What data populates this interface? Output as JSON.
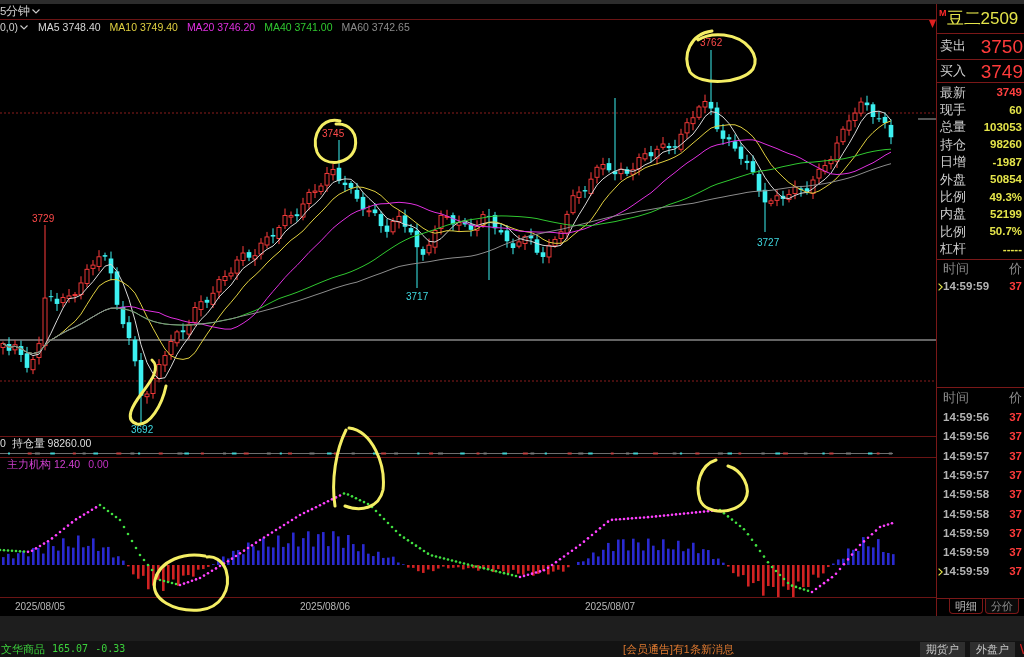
{
  "chart_header": {
    "period": "5分钟"
  },
  "legend": {
    "params": "0,0)",
    "averages": [
      {
        "label": "MA5",
        "value": "3748.40",
        "color": "#d8d8d8"
      },
      {
        "label": "MA10",
        "value": "3749.40",
        "color": "#e0d040"
      },
      {
        "label": "MA20",
        "value": "3746.20",
        "color": "#e030e0"
      },
      {
        "label": "MA40",
        "value": "3741.00",
        "color": "#30c830"
      },
      {
        "label": "MA60",
        "value": "3742.65",
        "color": "#8c8c8c"
      }
    ]
  },
  "price_marks": [
    {
      "text": "3729",
      "kind": "high"
    },
    {
      "text": "3692",
      "kind": "low"
    },
    {
      "text": "3745",
      "kind": "high"
    },
    {
      "text": "3717",
      "kind": "low"
    },
    {
      "text": "3762",
      "kind": "high"
    },
    {
      "text": "3727",
      "kind": "low"
    }
  ],
  "open_interest": {
    "prefix": "0",
    "label": "持仓量",
    "value": "98260.00"
  },
  "indicator": {
    "label": "主力机构",
    "value": "12.40",
    "value_2": "0.00"
  },
  "dates": [
    "2025/08/05",
    "2025/08/06",
    "2025/08/07"
  ],
  "quote_panel": {
    "marker": "M",
    "symbol": "豆二2509",
    "ask": {
      "label": "卖出",
      "value": "3750"
    },
    "bid": {
      "label": "买入",
      "value": "3749"
    },
    "stats": [
      {
        "label": "最新",
        "value": "3749",
        "kind": "price"
      },
      {
        "label": "现手",
        "value": "60",
        "kind": "amount"
      },
      {
        "label": "总量",
        "value": "103053",
        "kind": "amount"
      },
      {
        "label": "持仓",
        "value": "98260",
        "kind": "amount"
      },
      {
        "label": "日增",
        "value": "-1987",
        "kind": "amount"
      },
      {
        "label": "外盘",
        "value": "50854",
        "kind": "amount"
      },
      {
        "label": "比例",
        "value": "49.3%",
        "kind": "amount"
      },
      {
        "label": "内盘",
        "value": "52199",
        "kind": "amount"
      },
      {
        "label": "比例",
        "value": "50.7%",
        "kind": "amount"
      },
      {
        "label": "杠杆",
        "value": "-----",
        "kind": "amount"
      }
    ]
  },
  "latest_ticks": {
    "columns": [
      "时间",
      "价"
    ],
    "rows": [
      {
        "time": "14:59:59",
        "price": "37",
        "selected": true
      }
    ]
  },
  "tick_list": {
    "columns": [
      "时间",
      "价"
    ],
    "rows": [
      {
        "time": "14:59:56",
        "price": "37",
        "selected": false
      },
      {
        "time": "14:59:56",
        "price": "37",
        "selected": false
      },
      {
        "time": "14:59:57",
        "price": "37",
        "selected": false
      },
      {
        "time": "14:59:57",
        "price": "37",
        "selected": false
      },
      {
        "time": "14:59:58",
        "price": "37",
        "selected": false
      },
      {
        "time": "14:59:58",
        "price": "37",
        "selected": false
      },
      {
        "time": "14:59:59",
        "price": "37",
        "selected": false
      },
      {
        "time": "14:59:59",
        "price": "37",
        "selected": false
      },
      {
        "time": "14:59:59",
        "price": "37",
        "selected": true
      }
    ]
  },
  "panel_tabs": [
    {
      "label": "明细",
      "selected": true
    },
    {
      "label": "分价",
      "selected": false
    }
  ],
  "status_bar": {
    "index_name": "文华商品",
    "index_value": "165.07",
    "index_change": "-0.33",
    "notice": "[会员通告]有1条新消息",
    "buttons": [
      "期货户",
      "外盘户"
    ]
  }
}
